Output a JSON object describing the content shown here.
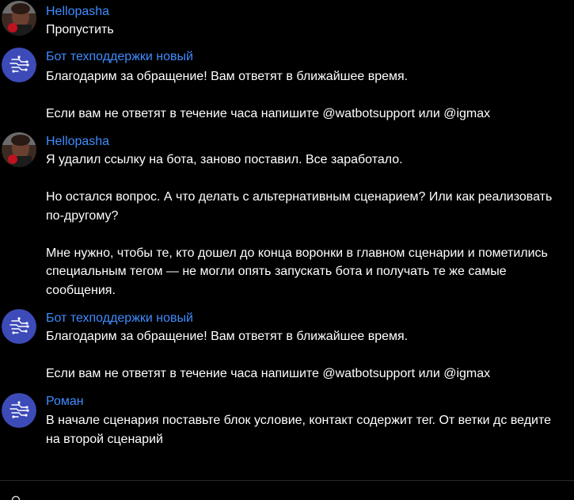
{
  "messages": [
    {
      "author": "Hellopasha",
      "avatar": "user-photo-avatar",
      "paragraphs": [
        "Пропустить"
      ]
    },
    {
      "author": "Бот техподдержки новый",
      "avatar": "bot-circuit-avatar",
      "paragraphs": [
        "Благодарим за обращение! Вам ответят в ближайшее время.",
        "Если вам не ответят в течение часа напишите @watbotsupport или @igmax"
      ]
    },
    {
      "author": "Hellopasha",
      "avatar": "user-photo-avatar",
      "paragraphs": [
        "Я удалил ссылку на бота, заново поставил. Все заработало.",
        "Но остался вопрос. А что делать с альтернативным сценарием? Или как реализовать по-другому?",
        "Мне нужно, чтобы те, кто дошел до конца воронки в главном сценарии и пометились специальным тегом — не могли опять запускать бота и получать те же самые сообщения."
      ]
    },
    {
      "author": "Бот техподдержки новый",
      "avatar": "bot-circuit-avatar",
      "paragraphs": [
        "Благодарим за обращение! Вам ответят в ближайшее время.",
        "Если вам не ответят в течение часа напишите @watbotsupport или @igmax"
      ]
    },
    {
      "author": "Роман",
      "avatar": "bot-circuit-avatar",
      "paragraphs": [
        "В начале сценария поставьте блок условие, контакт содержит тег. От ветки дс ведите на второй сценарий"
      ]
    }
  ],
  "colors": {
    "background": "#000000",
    "author": "#3f8cff",
    "text": "#ffffff",
    "bot_avatar_bg": "#3d4bb8"
  },
  "icons": {
    "bot_avatar": "circuit-brain-icon",
    "user_avatar": "user-photo",
    "bottom": "search-icon"
  }
}
